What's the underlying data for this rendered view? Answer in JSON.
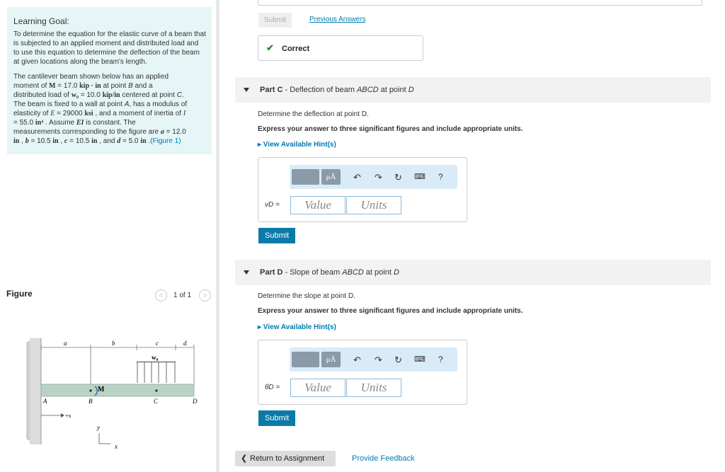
{
  "goal": {
    "heading": "Learning Goal:",
    "paragraph1": "To determine the equation for the elastic curve of a beam that is subjected to an applied moment and distributed load and to use this equation to determine the deflection of the beam at given locations along the beam's length.",
    "p2_line1a": "The cantilever beam shown below has an applied",
    "p2_line2a": "moment of ",
    "M_sym": "M",
    "M_val": " = 17.0 ",
    "M_unit": "kip · in",
    "p2_line2b": " at point ",
    "pointB": "B",
    "p2_line2c": " and a",
    "p2_line3a": "distributed load of ",
    "w0_sym": "w₀",
    "w0_val": " = 10.0 ",
    "w0_unit": "kip/in",
    "p2_line3b": " centered at point ",
    "pointC": "C",
    "p2_line3c": ".",
    "p2_line4a": "The beam is fixed to a wall at point ",
    "pointA": "A",
    "p2_line4b": ", has a modulus of",
    "p2_line5a": "elasticity of ",
    "E_sym": "E",
    "E_val": " = 29000 ",
    "E_unit": "ksi",
    "p2_line5b": " , and a moment of inertia of ",
    "I_sym": "I",
    "p2_line6a": "= 55.0 ",
    "I_unit": "in⁴",
    "p2_line6b": " . Assume ",
    "EI_sym": "EI",
    "p2_line6c": " is constant. The",
    "p2_line7": "measurements corresponding to the figure are ",
    "a_sym": "a",
    "a_val": " = 12.0",
    "in1": "in",
    "sep1": " , ",
    "b_sym": "b",
    "b_val": " = 10.5 ",
    "in2": "in",
    "sep2": " , ",
    "c_sym": "c",
    "c_val": " = 10.5 ",
    "in3": "in",
    "sep3": " , and ",
    "d_sym": "d",
    "d_val": " = 5.0 ",
    "in4": "in",
    "sep4": " .",
    "figure_link": "(Figure 1)"
  },
  "figure": {
    "label": "Figure",
    "pager": "1 of 1",
    "prev": "<",
    "next": ">",
    "labels": {
      "a": "a",
      "b": "b",
      "c": "c",
      "d": "d",
      "w0": "w₀",
      "M": "M",
      "A": "A",
      "B": "B",
      "C": "C",
      "D": "D",
      "plusx": "+x",
      "y": "y",
      "x": "x"
    },
    "beam_color": "#b9d3c7",
    "wall_color": "#cccccc"
  },
  "top": {
    "submit": "Submit",
    "previous_answers": "Previous Answers",
    "correct": "Correct"
  },
  "partC": {
    "letter": "Part C",
    "dash": " - ",
    "title_a": "Deflection of beam ",
    "beam": "ABCD",
    "title_b": " at point ",
    "point": "D",
    "prompt": "Determine the deflection at point D.",
    "instruction": "Express your answer to three significant figures and include appropriate units.",
    "hints": "▸ View Available Hint(s)",
    "var_label": "vD =",
    "value_placeholder": "Value",
    "units_placeholder": "Units",
    "submit": "Submit"
  },
  "partD": {
    "letter": "Part D",
    "dash": " - ",
    "title_a": "Slope of beam ",
    "beam": "ABCD",
    "title_b": " at point ",
    "point": "D",
    "prompt": "Determine the slope at point D.",
    "instruction": "Express your answer to three significant figures and include appropriate units.",
    "hints": "▸ View Available Hint(s)",
    "var_label": "θD =",
    "value_placeholder": "Value",
    "units_placeholder": "Units",
    "submit": "Submit"
  },
  "toolbar": {
    "mu": "μÅ",
    "undo_icon": "undo-icon",
    "redo_icon": "redo-icon",
    "reset_icon": "reset-icon",
    "keyboard_icon": "keyboard-icon",
    "help": "?"
  },
  "footer": {
    "return": "Return to Assignment",
    "return_arrow": "❮",
    "feedback": "Provide Feedback"
  },
  "colors": {
    "accent": "#007ab3",
    "submit_bg": "#0b7aa7",
    "goal_bg": "#e6f5f6",
    "correct_check": "#2e8b2e"
  }
}
